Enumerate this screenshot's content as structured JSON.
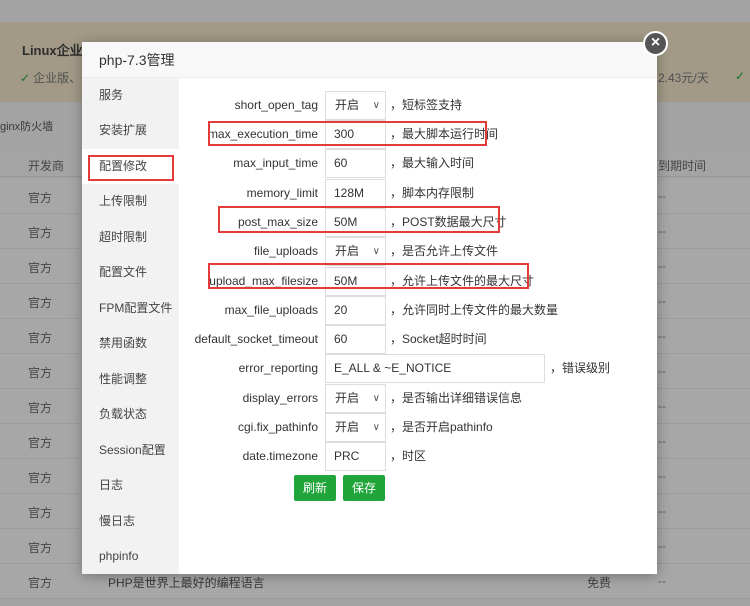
{
  "background": {
    "banner_title": "Linux企业",
    "banner_sub": "企业版、",
    "banner_price": "2.43元/天",
    "firewall_label": "ginx防火墙",
    "col_developer": "开发商",
    "col_expire": "到期时间",
    "rows": [
      {
        "developer": "官方",
        "expire": "--"
      },
      {
        "developer": "官方",
        "expire": "--"
      },
      {
        "developer": "官方",
        "expire": "--"
      },
      {
        "developer": "官方",
        "expire": "--"
      },
      {
        "developer": "官方",
        "expire": "--"
      },
      {
        "developer": "官方",
        "expire": "--"
      },
      {
        "developer": "官方",
        "expire": "--"
      },
      {
        "developer": "官方",
        "expire": "--"
      },
      {
        "developer": "官方",
        "expire": "--"
      },
      {
        "developer": "官方",
        "expire": "--"
      },
      {
        "developer": "官方",
        "expire": "--"
      },
      {
        "developer": "官方",
        "expire": "--",
        "desc": "PHP是世界上最好的编程语言",
        "price": "免费"
      }
    ]
  },
  "modal": {
    "title": "php-7.3管理",
    "close_glyph": "×",
    "sidebar": [
      {
        "label": "服务"
      },
      {
        "label": "安装扩展"
      },
      {
        "label": "配置修改"
      },
      {
        "label": "上传限制"
      },
      {
        "label": "超时限制"
      },
      {
        "label": "配置文件"
      },
      {
        "label": "FPM配置文件"
      },
      {
        "label": "禁用函数"
      },
      {
        "label": "性能调整"
      },
      {
        "label": "负载状态"
      },
      {
        "label": "Session配置"
      },
      {
        "label": "日志"
      },
      {
        "label": "慢日志"
      },
      {
        "label": "phpinfo"
      }
    ],
    "fields": [
      {
        "label": "short_open_tag",
        "type": "select",
        "value": "开启",
        "hint": "，短标签支持"
      },
      {
        "label": "max_execution_time",
        "type": "input",
        "value": "300",
        "hint": "，最大脚本运行时间"
      },
      {
        "label": "max_input_time",
        "type": "input",
        "value": "60",
        "hint": "，最大输入时间"
      },
      {
        "label": "memory_limit",
        "type": "input",
        "value": "128M",
        "hint": "，脚本内存限制"
      },
      {
        "label": "post_max_size",
        "type": "input",
        "value": "50M",
        "hint": "，POST数据最大尺寸"
      },
      {
        "label": "file_uploads",
        "type": "select",
        "value": "开启",
        "hint": "，是否允许上传文件"
      },
      {
        "label": "upload_max_filesize",
        "type": "input",
        "value": "50M",
        "hint": "，允许上传文件的最大尺寸"
      },
      {
        "label": "max_file_uploads",
        "type": "input",
        "value": "20",
        "hint": "，允许同时上传文件的最大数量"
      },
      {
        "label": "default_socket_timeout",
        "type": "input",
        "value": "60",
        "hint": "，Socket超时时间"
      },
      {
        "label": "error_reporting",
        "type": "input-wide",
        "value": "E_ALL & ~E_NOTICE",
        "hint": "，错误级别"
      },
      {
        "label": "display_errors",
        "type": "select",
        "value": "开启",
        "hint": "，是否输出详细错误信息"
      },
      {
        "label": "cgi.fix_pathinfo",
        "type": "select",
        "value": "开启",
        "hint": "，是否开启pathinfo"
      },
      {
        "label": "date.timezone",
        "type": "input",
        "value": "PRC",
        "hint": "，时区"
      }
    ],
    "refresh_label": "刷新",
    "save_label": "保存",
    "highlight_color": "#e33a3a",
    "accent_color": "#20a53a"
  }
}
